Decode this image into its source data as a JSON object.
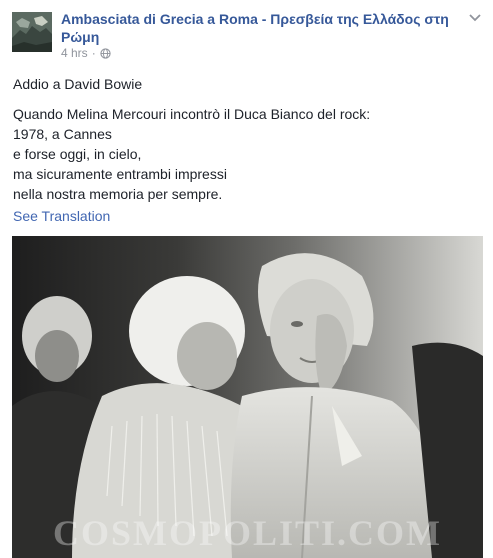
{
  "post": {
    "page_name": "Ambasciata di Grecia a Roma - Πρεσβεία της Ελλάδος στη Ρώμη",
    "timestamp": "4 hrs",
    "separator": "·",
    "privacy_icon": "globe-icon",
    "menu_icon": "chevron-down-icon",
    "text_title": "Addio a David Bowie",
    "text_lines": [
      "Quando Melina Mercouri incontrò il Duca Bianco del rock:",
      "1978, a Cannes",
      "e forse oggi, in cielo,",
      "ma sicuramente entrambi impressi",
      "nella nostra memoria per sempre."
    ],
    "see_translation": "See Translation",
    "photo_watermark": "COSMOPOLITI.COM"
  },
  "colors": {
    "link": "#365899",
    "link_secondary": "#4267b2",
    "meta": "#90949c",
    "text": "#1d2129"
  }
}
